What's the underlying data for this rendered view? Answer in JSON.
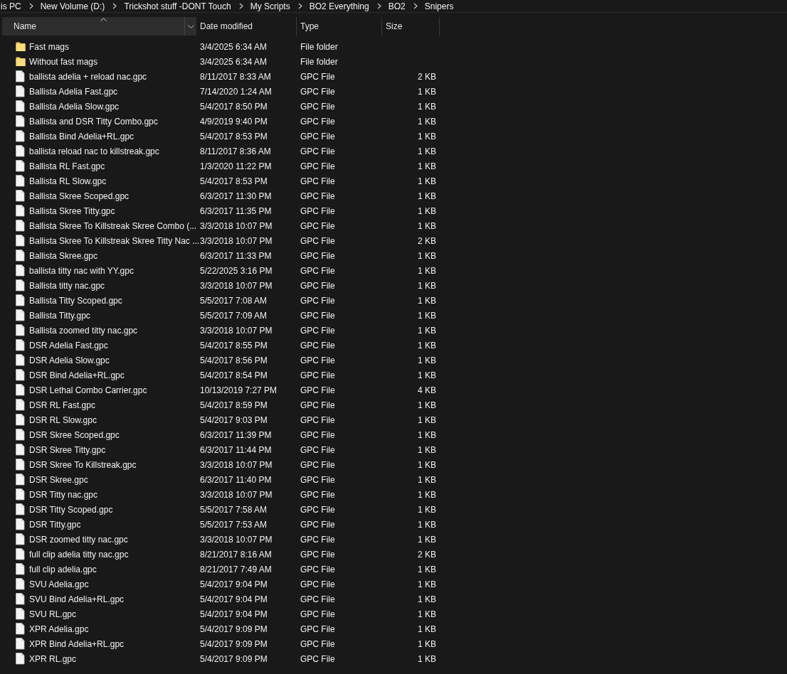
{
  "breadcrumb": [
    "is PC",
    "New Volume (D:)",
    "Trickshot stuff -DONT Touch",
    "My Scripts",
    "BO2 Everything",
    "BO2",
    "Snipers"
  ],
  "columns": [
    {
      "label": "Name",
      "sorted": true
    },
    {
      "label": "Date modified",
      "sorted": false
    },
    {
      "label": "Type",
      "sorted": false
    },
    {
      "label": "Size",
      "sorted": false
    }
  ],
  "rows": [
    {
      "kind": "folder",
      "name": "Fast mags",
      "date": "3/4/2025 6:34 AM",
      "type": "File folder"
    },
    {
      "kind": "folder",
      "name": "Without fast mags",
      "date": "3/4/2025 6:34 AM",
      "type": "File folder"
    },
    {
      "kind": "file",
      "name": "ballista adelia + reload nac.gpc",
      "date": "8/11/2017 8:33 AM",
      "type": "GPC File",
      "size": "2 KB"
    },
    {
      "kind": "file",
      "name": "Ballista Adelia Fast.gpc",
      "date": "7/14/2020 1:24 AM",
      "type": "GPC File",
      "size": "1 KB"
    },
    {
      "kind": "file",
      "name": "Ballista Adelia Slow.gpc",
      "date": "5/4/2017 8:50 PM",
      "type": "GPC File",
      "size": "1 KB"
    },
    {
      "kind": "file",
      "name": "Ballista and DSR Titty Combo.gpc",
      "date": "4/9/2019 9:40 PM",
      "type": "GPC File",
      "size": "1 KB"
    },
    {
      "kind": "file",
      "name": "Ballista Bind Adelia+RL.gpc",
      "date": "5/4/2017 8:53 PM",
      "type": "GPC File",
      "size": "1 KB"
    },
    {
      "kind": "file",
      "name": "ballista reload nac to killstreak.gpc",
      "date": "8/11/2017 8:36 AM",
      "type": "GPC File",
      "size": "1 KB"
    },
    {
      "kind": "file",
      "name": "Ballista RL Fast.gpc",
      "date": "1/3/2020 11:22 PM",
      "type": "GPC File",
      "size": "1 KB"
    },
    {
      "kind": "file",
      "name": "Ballista RL Slow.gpc",
      "date": "5/4/2017 8:53 PM",
      "type": "GPC File",
      "size": "1 KB"
    },
    {
      "kind": "file",
      "name": "Ballista Skree Scoped.gpc",
      "date": "6/3/2017 11:30 PM",
      "type": "GPC File",
      "size": "1 KB"
    },
    {
      "kind": "file",
      "name": "Ballista Skree Titty.gpc",
      "date": "6/3/2017 11:35 PM",
      "type": "GPC File",
      "size": "1 KB"
    },
    {
      "kind": "file",
      "name": "Ballista Skree To Killstreak Skree Combo (...",
      "date": "3/3/2018 10:07 PM",
      "type": "GPC File",
      "size": "1 KB"
    },
    {
      "kind": "file",
      "name": "Ballista Skree To Killstreak Skree Titty Nac ...",
      "date": "3/3/2018 10:07 PM",
      "type": "GPC File",
      "size": "2 KB"
    },
    {
      "kind": "file",
      "name": "Ballista Skree.gpc",
      "date": "6/3/2017 11:33 PM",
      "type": "GPC File",
      "size": "1 KB"
    },
    {
      "kind": "file",
      "name": "ballista titty nac with YY.gpc",
      "date": "5/22/2025 3:16 PM",
      "type": "GPC File",
      "size": "1 KB"
    },
    {
      "kind": "file",
      "name": "Ballista titty nac.gpc",
      "date": "3/3/2018 10:07 PM",
      "type": "GPC File",
      "size": "1 KB"
    },
    {
      "kind": "file",
      "name": "Ballista Titty Scoped.gpc",
      "date": "5/5/2017 7:08 AM",
      "type": "GPC File",
      "size": "1 KB"
    },
    {
      "kind": "file",
      "name": "Ballista Titty.gpc",
      "date": "5/5/2017 7:09 AM",
      "type": "GPC File",
      "size": "1 KB"
    },
    {
      "kind": "file",
      "name": "Ballista zoomed titty nac.gpc",
      "date": "3/3/2018 10:07 PM",
      "type": "GPC File",
      "size": "1 KB"
    },
    {
      "kind": "file",
      "name": "DSR Adelia Fast.gpc",
      "date": "5/4/2017 8:55 PM",
      "type": "GPC File",
      "size": "1 KB"
    },
    {
      "kind": "file",
      "name": "DSR Adelia Slow.gpc",
      "date": "5/4/2017 8:56 PM",
      "type": "GPC File",
      "size": "1 KB"
    },
    {
      "kind": "file",
      "name": "DSR Bind Adelia+RL.gpc",
      "date": "5/4/2017 8:54 PM",
      "type": "GPC File",
      "size": "1 KB"
    },
    {
      "kind": "file",
      "name": "DSR Lethal Combo Carrier.gpc",
      "date": "10/13/2019 7:27 PM",
      "type": "GPC File",
      "size": "4 KB"
    },
    {
      "kind": "file",
      "name": "DSR RL Fast.gpc",
      "date": "5/4/2017 8:59 PM",
      "type": "GPC File",
      "size": "1 KB"
    },
    {
      "kind": "file",
      "name": "DSR RL Slow.gpc",
      "date": "5/4/2017 9:03 PM",
      "type": "GPC File",
      "size": "1 KB"
    },
    {
      "kind": "file",
      "name": "DSR Skree Scoped.gpc",
      "date": "6/3/2017 11:39 PM",
      "type": "GPC File",
      "size": "1 KB"
    },
    {
      "kind": "file",
      "name": "DSR Skree Titty.gpc",
      "date": "6/3/2017 11:44 PM",
      "type": "GPC File",
      "size": "1 KB"
    },
    {
      "kind": "file",
      "name": "DSR Skree To Killstreak.gpc",
      "date": "3/3/2018 10:07 PM",
      "type": "GPC File",
      "size": "1 KB"
    },
    {
      "kind": "file",
      "name": "DSR Skree.gpc",
      "date": "6/3/2017 11:40 PM",
      "type": "GPC File",
      "size": "1 KB"
    },
    {
      "kind": "file",
      "name": "DSR Titty nac.gpc",
      "date": "3/3/2018 10:07 PM",
      "type": "GPC File",
      "size": "1 KB"
    },
    {
      "kind": "file",
      "name": "DSR Titty Scoped.gpc",
      "date": "5/5/2017 7:58 AM",
      "type": "GPC File",
      "size": "1 KB"
    },
    {
      "kind": "file",
      "name": "DSR Titty.gpc",
      "date": "5/5/2017 7:53 AM",
      "type": "GPC File",
      "size": "1 KB"
    },
    {
      "kind": "file",
      "name": "DSR zoomed titty nac.gpc",
      "date": "3/3/2018 10:07 PM",
      "type": "GPC File",
      "size": "1 KB"
    },
    {
      "kind": "file",
      "name": "full clip adelia titty nac.gpc",
      "date": "8/21/2017 8:16 AM",
      "type": "GPC File",
      "size": "2 KB"
    },
    {
      "kind": "file",
      "name": "full clip adelia.gpc",
      "date": "8/21/2017 7:49 AM",
      "type": "GPC File",
      "size": "1 KB"
    },
    {
      "kind": "file",
      "name": "SVU Adelia.gpc",
      "date": "5/4/2017 9:04 PM",
      "type": "GPC File",
      "size": "1 KB"
    },
    {
      "kind": "file",
      "name": "SVU Bind Adelia+RL.gpc",
      "date": "5/4/2017 9:04 PM",
      "type": "GPC File",
      "size": "1 KB"
    },
    {
      "kind": "file",
      "name": "SVU RL.gpc",
      "date": "5/4/2017 9:04 PM",
      "type": "GPC File",
      "size": "1 KB"
    },
    {
      "kind": "file",
      "name": "XPR Adelia.gpc",
      "date": "5/4/2017 9:09 PM",
      "type": "GPC File",
      "size": "1 KB"
    },
    {
      "kind": "file",
      "name": "XPR Bind Adelia+RL.gpc",
      "date": "5/4/2017 9:09 PM",
      "type": "GPC File",
      "size": "1 KB"
    },
    {
      "kind": "file",
      "name": "XPR RL.gpc",
      "date": "5/4/2017 9:09 PM",
      "type": "GPC File",
      "size": "1 KB"
    }
  ]
}
